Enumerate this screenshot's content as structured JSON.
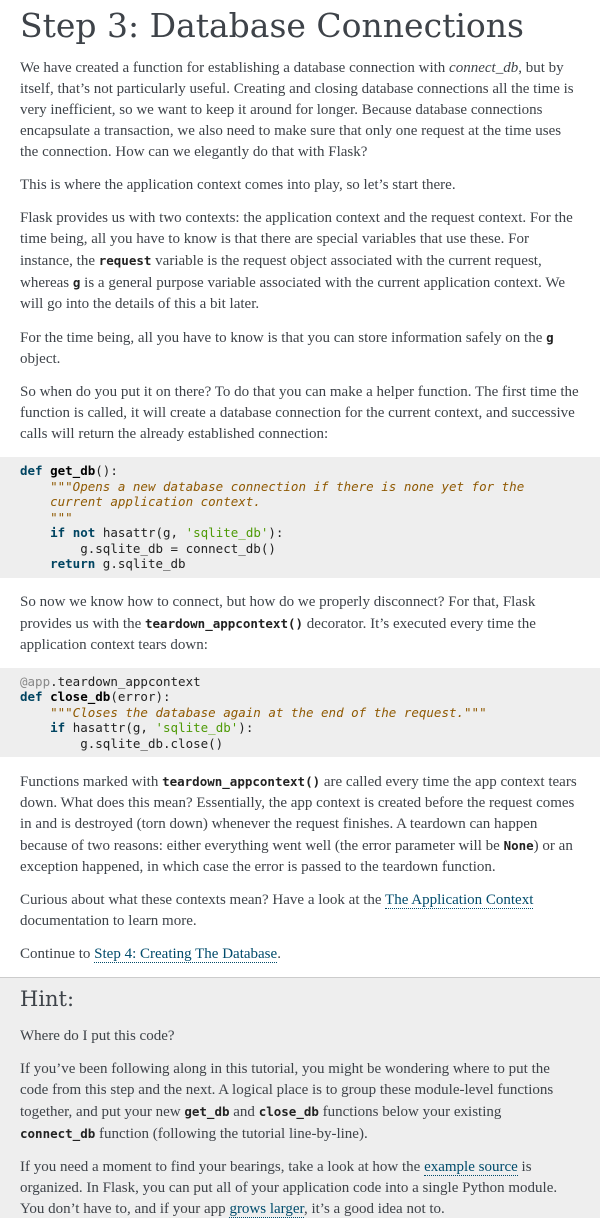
{
  "title": "Step 3: Database Connections",
  "p1": {
    "a": "We have created a function for establishing a database connection with ",
    "em": "connect_db",
    "b": ", but by itself, that’s not particularly useful. Creating and closing database connections all the time is very inefficient, so we want to keep it around for longer. Because database connections encapsulate a transaction, we also need to make sure that only one request at the time uses the connection. How can we elegantly do that with Flask?"
  },
  "p2": "This is where the application context comes into play, so let’s start there.",
  "p3": {
    "a": "Flask provides us with two contexts: the application context and the request context. For the time being, all you have to know is that there are special variables that use these. For instance, the ",
    "c1": "request",
    "b": " variable is the request object associated with the current request, whereas ",
    "c2": "g",
    "c": " is a general purpose variable associated with the current application context. We will go into the details of this a bit later."
  },
  "p4": {
    "a": "For the time being, all you have to know is that you can store information safely on the ",
    "c1": "g",
    "b": " object."
  },
  "p5": "So when do you put it on there? To do that you can make a helper function. The first time the function is called, it will create a database connection for the current context, and successive calls will return the already established connection:",
  "code1": {
    "def": "def",
    "fn": "get_db",
    "sig": "():",
    "doc1": "\"\"\"Opens a new database connection if there is none yet for the",
    "doc2": "current application context.",
    "doc3": "\"\"\"",
    "if": "if",
    "not": "not",
    "call": "hasattr(g,",
    "str": "'sqlite_db'",
    "close": "):",
    "assign": "g.sqlite_db = connect_db()",
    "return": "return",
    "ret": "g.sqlite_db"
  },
  "p6": {
    "a": "So now we know how to connect, but how do we properly disconnect? For that, Flask provides us with the ",
    "c1": "teardown_appcontext()",
    "b": " decorator. It’s executed every time the application context tears down:"
  },
  "code2": {
    "dec": "@app",
    "dec2": ".teardown_appcontext",
    "def": "def",
    "fn": "close_db",
    "sig": "(error):",
    "doc": "\"\"\"Closes the database again at the end of the request.\"\"\"",
    "if": "if",
    "call": "hasattr(g,",
    "str": "'sqlite_db'",
    "close": "):",
    "body": "g.sqlite_db.close()"
  },
  "p7": {
    "a": "Functions marked with ",
    "c1": "teardown_appcontext()",
    "b": " are called every time the app context tears down. What does this mean? Essentially, the app context is created before the request comes in and is destroyed (torn down) whenever the request finishes. A teardown can happen because of two reasons: either everything went well (the error parameter will be ",
    "c2": "None",
    "c": ") or an exception happened, in which case the error is passed to the teardown function."
  },
  "p8": {
    "a": "Curious about what these contexts mean? Have a look at the ",
    "link": "The Application Context",
    "b": " documentation to learn more."
  },
  "p9": {
    "a": "Continue to ",
    "link": "Step 4: Creating The Database",
    "b": "."
  },
  "hint": {
    "title": "Hint:",
    "q": "Where do I put this code?",
    "h1": {
      "a": "If you’ve been following along in this tutorial, you might be wondering where to put the code from this step and the next. A logical place is to group these module-level functions together, and put your new ",
      "c1": "get_db",
      "b": " and ",
      "c2": "close_db",
      "c": " functions below your existing ",
      "c3": "connect_db",
      "d": " function (following the tutorial line-by-line)."
    },
    "h2": {
      "a": "If you need a moment to find your bearings, take a look at how the ",
      "link1": "example source",
      "b": " is organized. In Flask, you can put all of your application code into a single Python module. You don’t have to, and if your app ",
      "link2": "grows larger",
      "c": ", it’s a good idea not to."
    }
  }
}
